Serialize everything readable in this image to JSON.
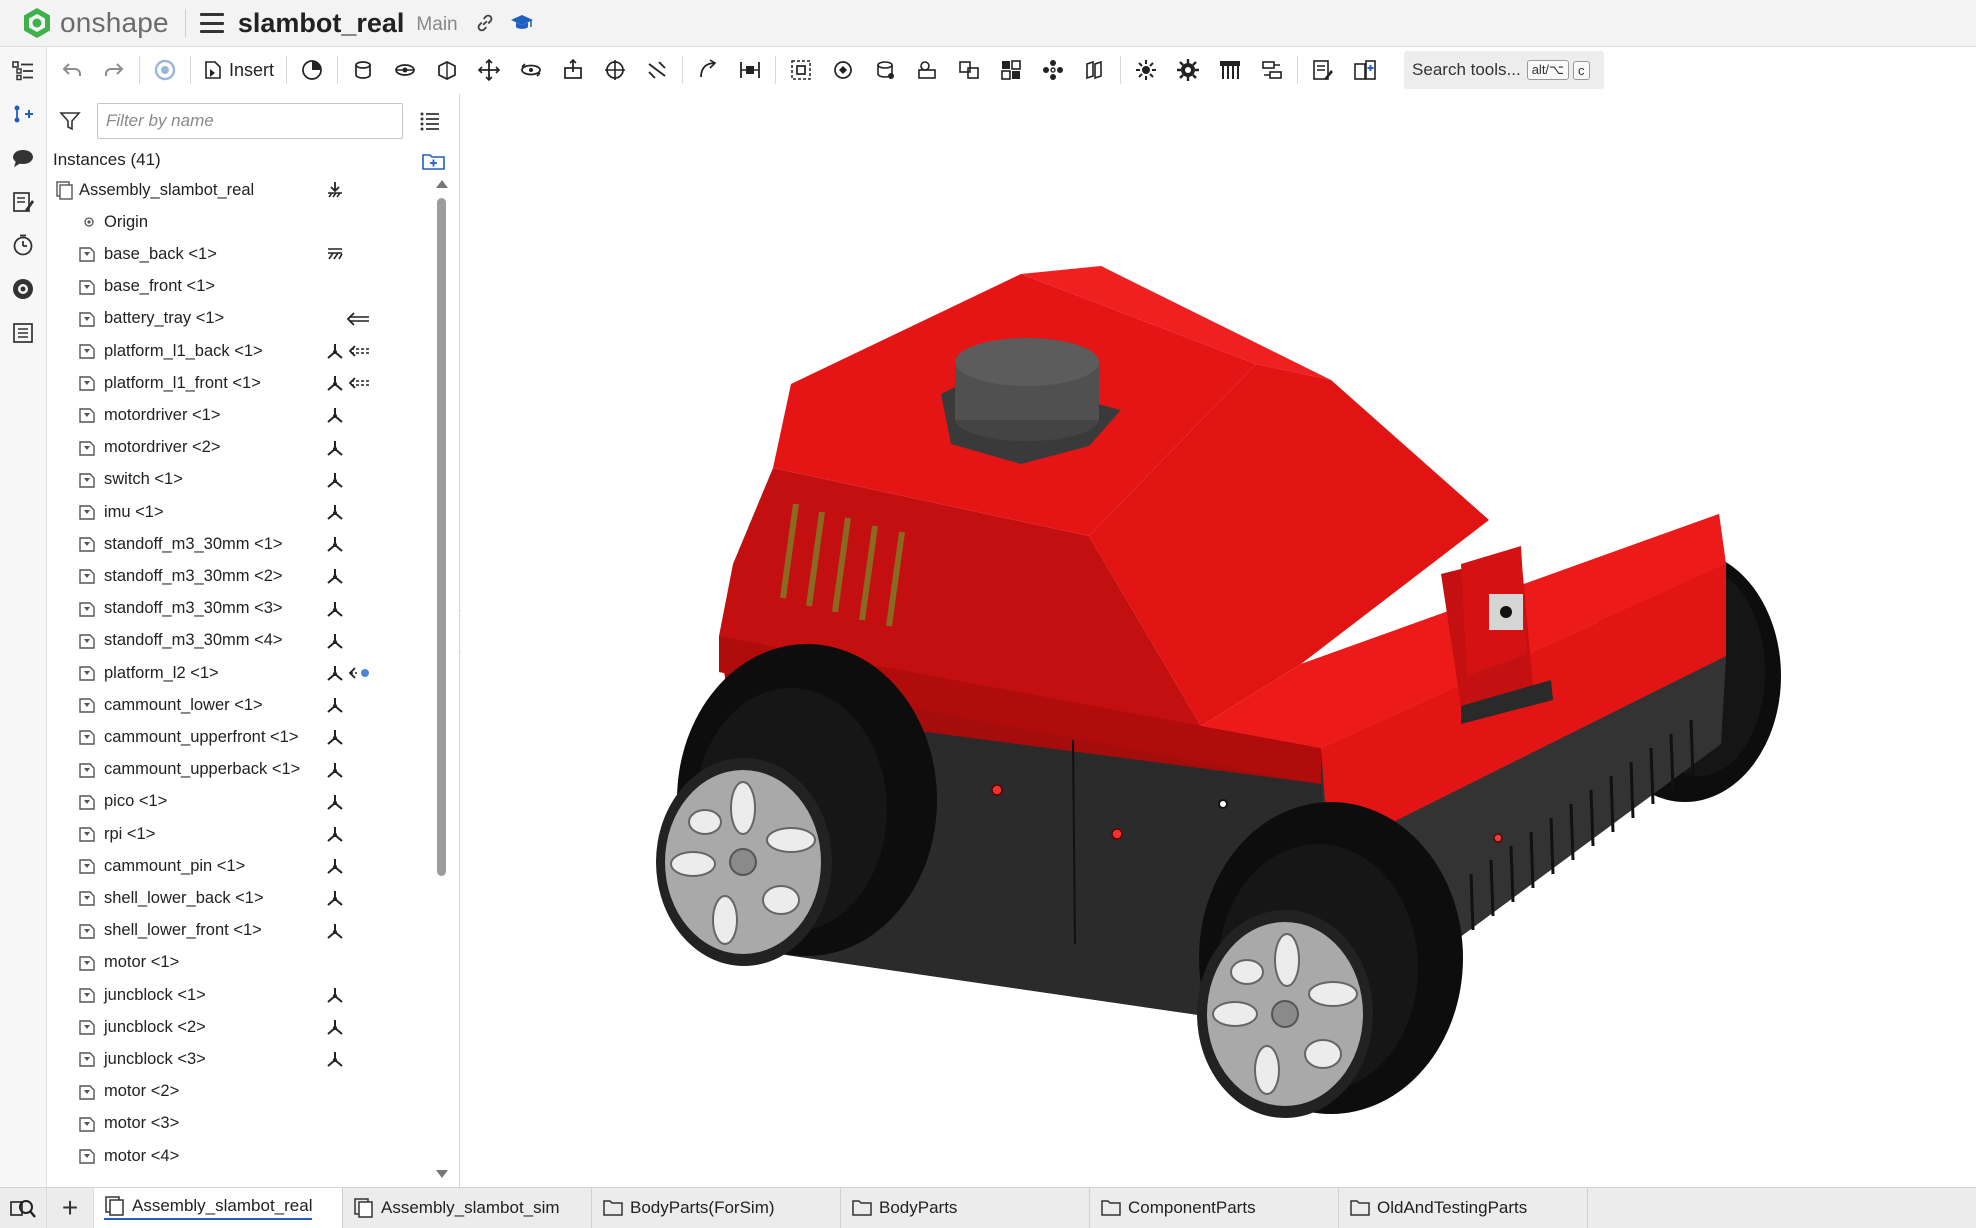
{
  "app": {
    "brand": "onshape",
    "doc_title": "slambot_real",
    "branch": "Main"
  },
  "toolbar": {
    "insert_label": "Insert",
    "search_label": "Search tools...",
    "shortcut_1": "alt/⌥",
    "shortcut_2": "c"
  },
  "panel": {
    "filter_placeholder": "Filter by name",
    "instances_title": "Instances (41)",
    "items": [
      {
        "label": "Assembly_slambot_real",
        "kind": "assembly",
        "mate": "",
        "extra": "fix"
      },
      {
        "label": "Origin",
        "kind": "origin",
        "mate": "",
        "extra": ""
      },
      {
        "label": "base_back <1>",
        "kind": "part",
        "mate": "",
        "extra": "fixed"
      },
      {
        "label": "base_front <1>",
        "kind": "part",
        "mate": "",
        "extra": ""
      },
      {
        "label": "battery_tray <1>",
        "kind": "part",
        "mate": "",
        "extra": "arrow"
      },
      {
        "label": "platform_l1_back <1>",
        "kind": "part",
        "mate": "mate",
        "extra": "arrow-dash"
      },
      {
        "label": "platform_l1_front <1>",
        "kind": "part",
        "mate": "mate",
        "extra": "arrow-dash"
      },
      {
        "label": "motordriver <1>",
        "kind": "part",
        "mate": "mate",
        "extra": ""
      },
      {
        "label": "motordriver <2>",
        "kind": "part",
        "mate": "mate",
        "extra": ""
      },
      {
        "label": "switch <1>",
        "kind": "part",
        "mate": "mate",
        "extra": ""
      },
      {
        "label": "imu <1>",
        "kind": "part",
        "mate": "mate",
        "extra": ""
      },
      {
        "label": "standoff_m3_30mm <1>",
        "kind": "part",
        "mate": "mate",
        "extra": ""
      },
      {
        "label": "standoff_m3_30mm <2>",
        "kind": "part",
        "mate": "mate",
        "extra": ""
      },
      {
        "label": "standoff_m3_30mm <3>",
        "kind": "part",
        "mate": "mate",
        "extra": ""
      },
      {
        "label": "standoff_m3_30mm <4>",
        "kind": "part",
        "mate": "mate",
        "extra": ""
      },
      {
        "label": "platform_l2 <1>",
        "kind": "part",
        "mate": "mate",
        "extra": "arrow-dot"
      },
      {
        "label": "cammount_lower <1>",
        "kind": "part",
        "mate": "mate",
        "extra": ""
      },
      {
        "label": "cammount_upperfront <1>",
        "kind": "part",
        "mate": "mate",
        "extra": ""
      },
      {
        "label": "cammount_upperback <1>",
        "kind": "part",
        "mate": "mate",
        "extra": ""
      },
      {
        "label": "pico <1>",
        "kind": "part",
        "mate": "mate",
        "extra": ""
      },
      {
        "label": "rpi <1>",
        "kind": "part",
        "mate": "mate",
        "extra": ""
      },
      {
        "label": "cammount_pin <1>",
        "kind": "part",
        "mate": "mate",
        "extra": ""
      },
      {
        "label": "shell_lower_back <1>",
        "kind": "part",
        "mate": "mate",
        "extra": ""
      },
      {
        "label": "shell_lower_front <1>",
        "kind": "part",
        "mate": "mate",
        "extra": ""
      },
      {
        "label": "motor <1>",
        "kind": "part",
        "mate": "",
        "extra": ""
      },
      {
        "label": "juncblock <1>",
        "kind": "part",
        "mate": "mate",
        "extra": ""
      },
      {
        "label": "juncblock <2>",
        "kind": "part",
        "mate": "mate",
        "extra": ""
      },
      {
        "label": "juncblock <3>",
        "kind": "part",
        "mate": "mate",
        "extra": ""
      },
      {
        "label": "motor <2>",
        "kind": "part",
        "mate": "",
        "extra": ""
      },
      {
        "label": "motor <3>",
        "kind": "part",
        "mate": "",
        "extra": ""
      },
      {
        "label": "motor <4>",
        "kind": "part",
        "mate": "",
        "extra": ""
      }
    ]
  },
  "tabs": [
    {
      "label": "Assembly_slambot_real",
      "kind": "assembly",
      "active": true
    },
    {
      "label": "Assembly_slambot_sim",
      "kind": "assembly",
      "active": false
    },
    {
      "label": "BodyParts(ForSim)",
      "kind": "folder",
      "active": false
    },
    {
      "label": "BodyParts",
      "kind": "folder",
      "active": false
    },
    {
      "label": "ComponentParts",
      "kind": "folder",
      "active": false
    },
    {
      "label": "OldAndTestingParts",
      "kind": "folder",
      "active": false
    }
  ],
  "colors": {
    "brand_green": "#3fb04a",
    "accent_blue": "#1f5fbf",
    "body_red": "#e01414",
    "body_dark_red": "#9e0b0b",
    "chassis_black": "#2b2b2b",
    "tire_black": "#0d0d0d",
    "rim_grey": "#a9a9a9"
  }
}
